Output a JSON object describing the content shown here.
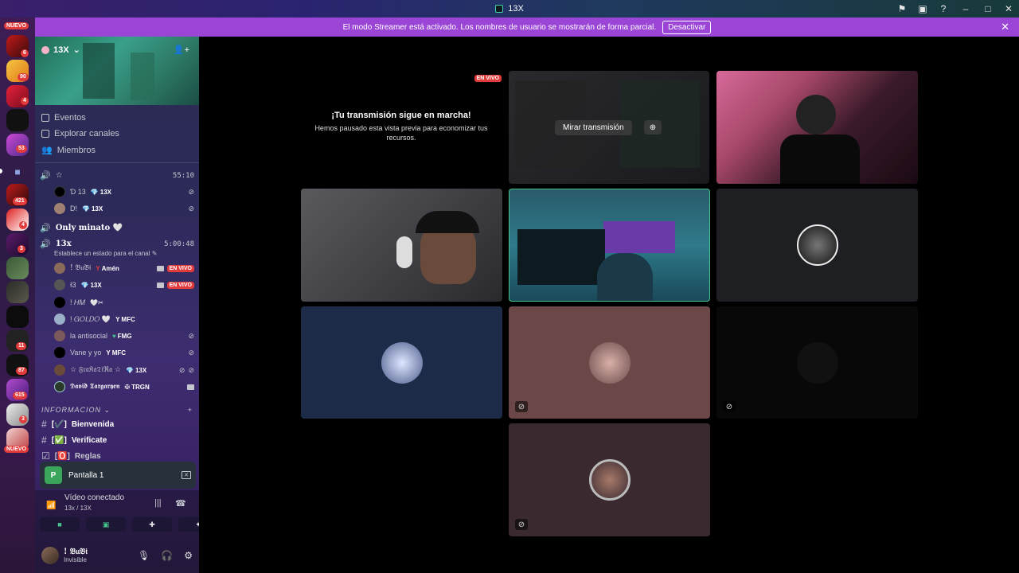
{
  "window": {
    "title": "13X"
  },
  "banner": {
    "message": "El modo Streamer está activado. Los nombres de usuario se mostrarán de forma parcial.",
    "button": "Desactivar"
  },
  "rail": {
    "nuevo_top": "NUEVO",
    "nuevo_bottom": "NUEVO",
    "badges": [
      "6",
      "90",
      "4",
      "53",
      "421",
      "4",
      "3",
      "11",
      "87",
      "615",
      "3"
    ]
  },
  "server": {
    "name": "13X"
  },
  "nav": {
    "events": "Eventos",
    "explore": "Explorar canales",
    "members": "Miembros"
  },
  "voice1": {
    "name": "☆",
    "time": "55:10",
    "users": [
      {
        "name": "Ɗ 13",
        "tag": "13X"
      },
      {
        "name": "D!",
        "tag": "13X"
      }
    ]
  },
  "voice_only": {
    "name": "Only minato 🤍"
  },
  "voice2": {
    "name": "13x",
    "time": "5:00:48",
    "status": "Establece un estado para el canal",
    "users": [
      {
        "name": "! 𝔅𝔲𝔅𝔦",
        "tag": "Amén",
        "live": "EN VIVO"
      },
      {
        "name": "Ɨ3",
        "tag": "13X",
        "live": "EN VIVO"
      },
      {
        "name": "! 𝐻𝑀",
        "tag": ""
      },
      {
        "name": "! 𝐺𝑂𝐿𝐷𝑂 🤍",
        "tag": "MFC"
      },
      {
        "name": "la antisocial",
        "tag": "FMG"
      },
      {
        "name": "Vane y yo",
        "tag": "MFC"
      },
      {
        "name": "☆ 𝔉𝔯𝔞𝔎𝔞𝔗𝔦ℜ𝔞 ☆",
        "tag": "13X"
      },
      {
        "name": "𝕯𝖆𝖛𝖎𝖉 𝕿𝖆𝖗𝖌𝖆𝖗𝖞𝖊𝖓",
        "tag": "TRGN"
      }
    ]
  },
  "category": {
    "name": "INFORMACION"
  },
  "text_channels": [
    {
      "prefix": "[✔️]",
      "name": "Bienvenida"
    },
    {
      "prefix": "[✅]",
      "name": "Verificate"
    },
    {
      "prefix": "[🅾️]",
      "name": "Reglas"
    }
  ],
  "screen_share": {
    "label": "Pantalla 1"
  },
  "rtc": {
    "status": "Vídeo conectado",
    "channel": "13x / 13X"
  },
  "user": {
    "name": "! 𝔅𝔲𝔅𝔦",
    "status": "Invisible"
  },
  "stream": {
    "live": "EN VIVO",
    "heading": "¡Tu transmisión sigue en marcha!",
    "body": "Hemos pausado esta vista previa para economizar tus recursos.",
    "watch": "Mirar transmisión"
  },
  "colors": {
    "accent": "#9b45d6",
    "live": "#e23b3b",
    "speaking": "#45c58c"
  }
}
